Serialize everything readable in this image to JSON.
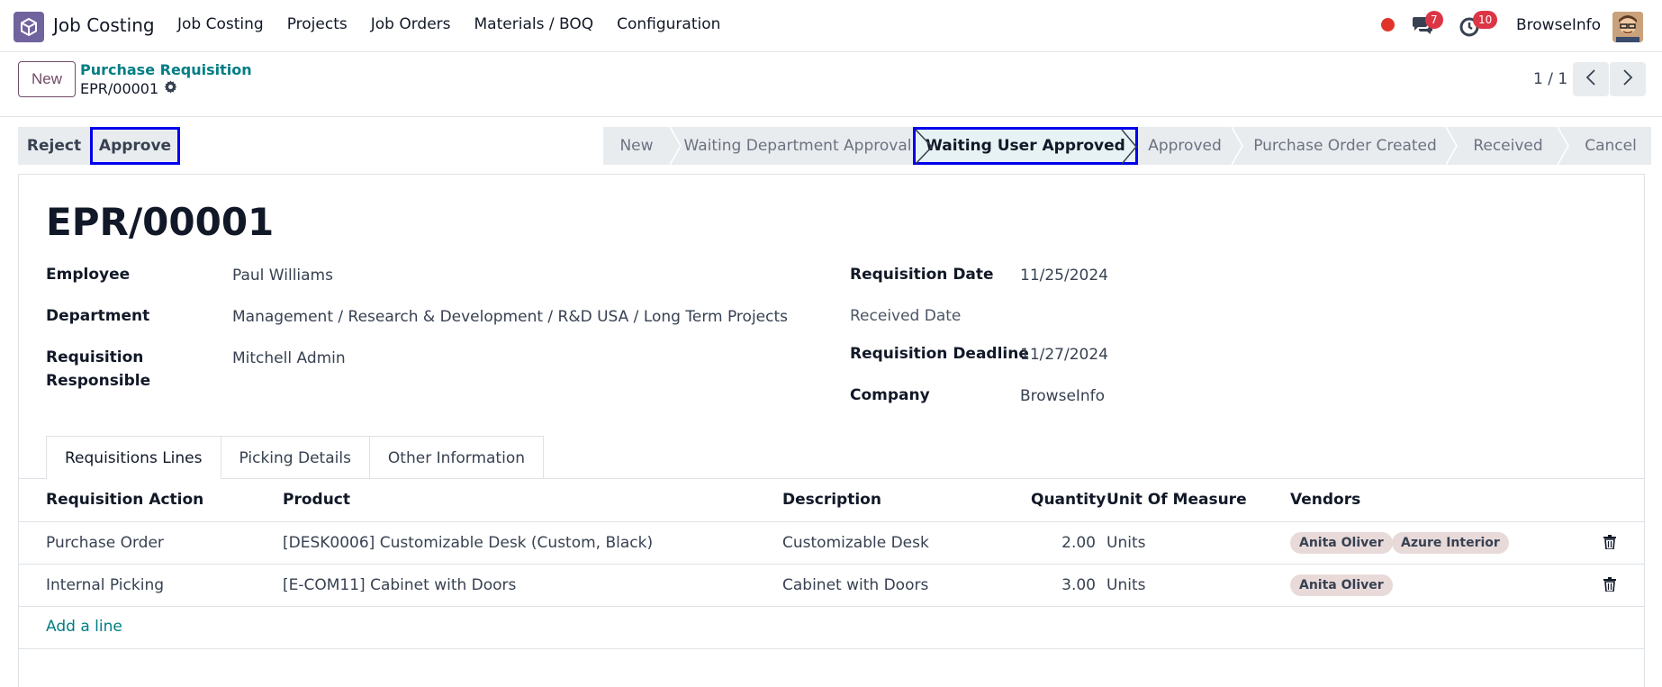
{
  "navbar": {
    "app_name": "Job Costing",
    "menu": [
      "Job Costing",
      "Projects",
      "Job Orders",
      "Materials / BOQ",
      "Configuration"
    ],
    "chat_count": "7",
    "activity_count": "10",
    "company": "BrowseInfo"
  },
  "control": {
    "new_label": "New",
    "breadcrumb_parent": "Purchase Requisition",
    "breadcrumb_current": "EPR/00001",
    "pager": "1 / 1"
  },
  "actions": {
    "reject_label": "Reject",
    "approve_label": "Approve"
  },
  "statusbar": {
    "stages": [
      "New",
      "Waiting Department Approval",
      "Waiting User Approved",
      "Approved",
      "Purchase Order Created",
      "Received",
      "Cancel"
    ],
    "active_stage": "Waiting User Approved"
  },
  "form": {
    "title": "EPR/00001",
    "employee_label": "Employee",
    "employee": "Paul Williams",
    "department_label": "Department",
    "department": "Management / Research & Development / R&D USA / Long Term Projects",
    "responsible_label_1": "Requisition",
    "responsible_label_2": "Responsible",
    "responsible": "Mitchell Admin",
    "req_date_label": "Requisition Date",
    "req_date": "11/25/2024",
    "received_date_label": "Received Date",
    "received_date": "",
    "deadline_label": "Requisition Deadline",
    "deadline": "11/27/2024",
    "company_label": "Company",
    "company": "BrowseInfo"
  },
  "tabs": [
    "Requisitions Lines",
    "Picking Details",
    "Other Information"
  ],
  "lines": {
    "headers": {
      "action": "Requisition Action",
      "product": "Product",
      "description": "Description",
      "quantity": "Quantity",
      "uom": "Unit Of Measure",
      "vendors": "Vendors"
    },
    "rows": [
      {
        "action": "Purchase Order",
        "product": "[DESK0006] Customizable Desk (Custom, Black)",
        "description": "Customizable Desk",
        "quantity": "2.00",
        "uom": "Units",
        "vendors": [
          "Anita Oliver",
          "Azure Interior"
        ]
      },
      {
        "action": "Internal Picking",
        "product": "[E-COM11] Cabinet with Doors",
        "description": "Cabinet with Doors",
        "quantity": "3.00",
        "uom": "Units",
        "vendors": [
          "Anita Oliver"
        ]
      }
    ],
    "add_line": "Add a line"
  },
  "colors": {
    "brand": "#714b67",
    "link": "#017e84",
    "highlight": "#0000ee"
  }
}
